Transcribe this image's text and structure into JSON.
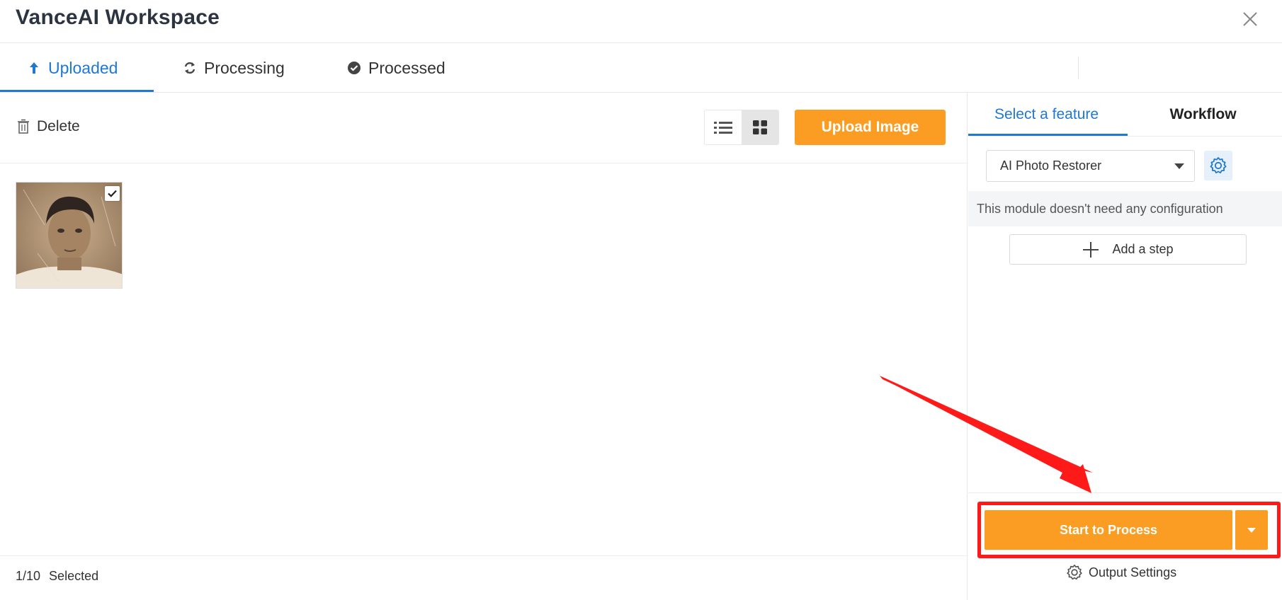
{
  "app": {
    "title": "VanceAI Workspace",
    "close_icon": "close-icon"
  },
  "tabs": [
    {
      "label": "Uploaded",
      "icon": "upload-arrow-icon",
      "active": true
    },
    {
      "label": "Processing",
      "icon": "refresh-icon",
      "active": false
    },
    {
      "label": "Processed",
      "icon": "check-circle-icon",
      "active": false
    }
  ],
  "toolbar": {
    "delete_label": "Delete",
    "upload_label": "Upload Image",
    "view_modes": [
      "list",
      "grid"
    ],
    "active_view": "grid"
  },
  "gallery": {
    "items": [
      {
        "description": "old sepia portrait photo",
        "selected": true
      }
    ]
  },
  "footer": {
    "count": "1/10",
    "selected_label": "Selected"
  },
  "sidebar": {
    "tabs": [
      {
        "label": "Select a feature",
        "active": true
      },
      {
        "label": "Workflow",
        "active": false
      }
    ],
    "feature_value": "AI Photo Restorer",
    "config_note": "This module doesn't need any configuration",
    "add_step_label": "Add a step",
    "start_label": "Start to Process",
    "output_settings_label": "Output Settings"
  },
  "colors": {
    "accent_blue": "#1f78d1",
    "accent_orange": "#fb9d23",
    "highlight_red": "#ff1a1a"
  }
}
